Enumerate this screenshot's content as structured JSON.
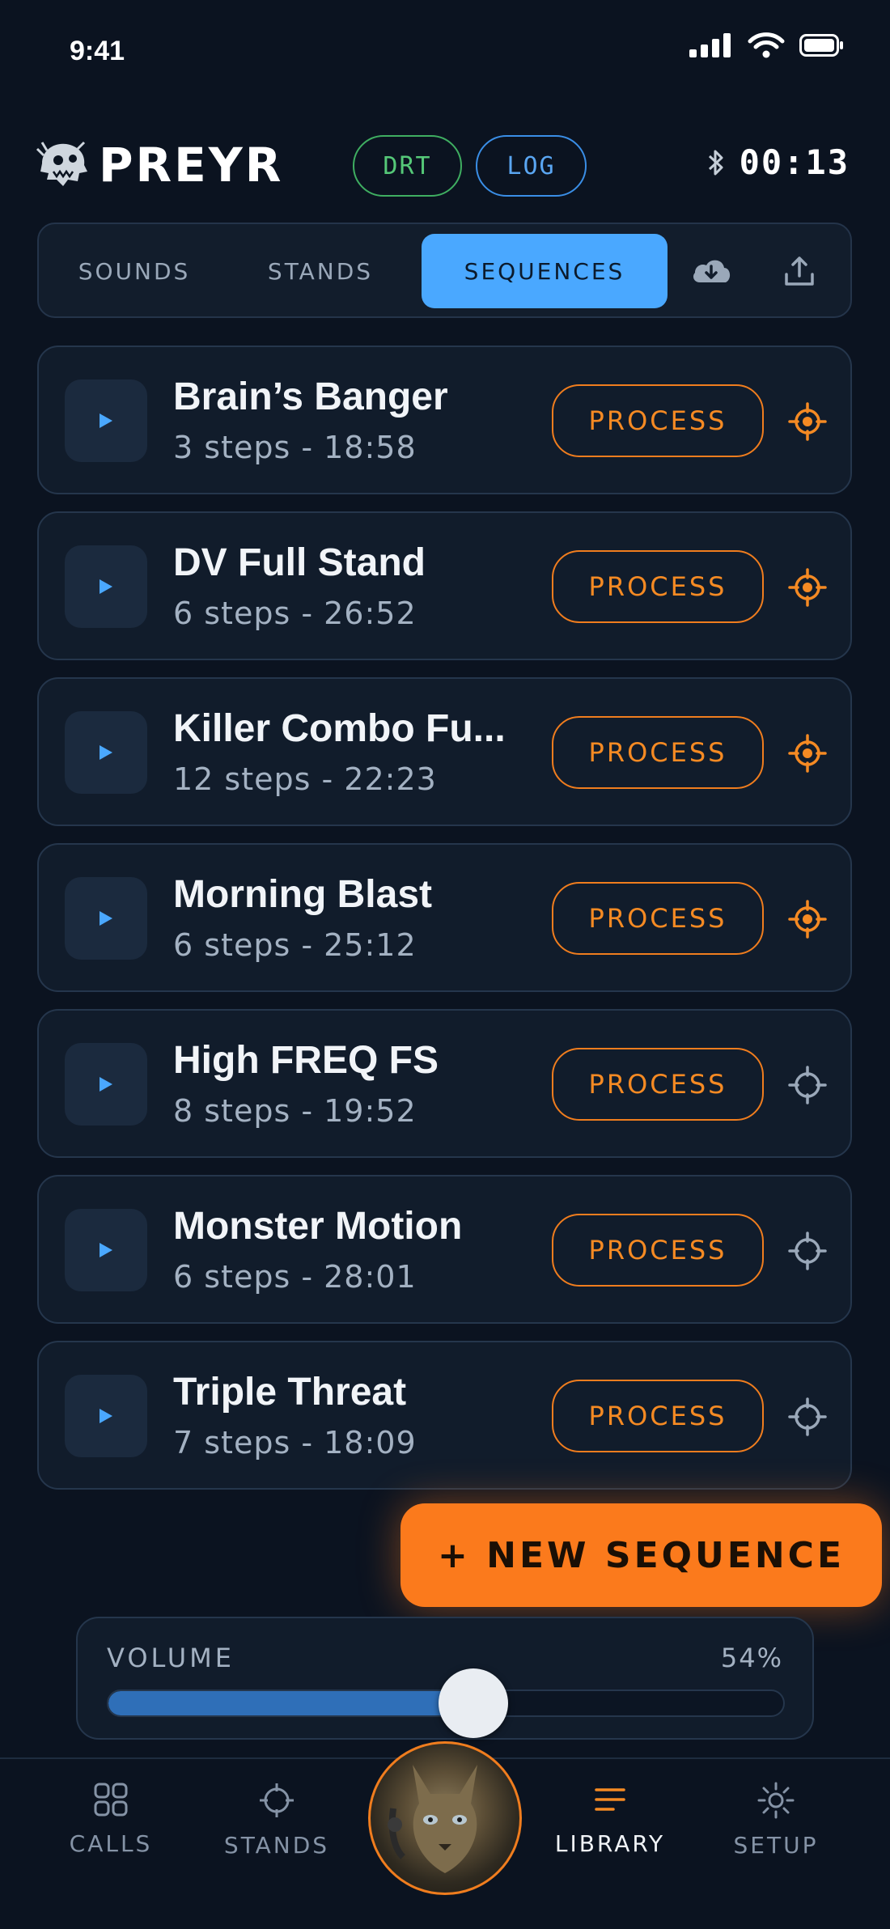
{
  "status_bar": {
    "time": "9:41"
  },
  "header": {
    "logo_text": "PREYR",
    "pill_drt": "DRT",
    "pill_log": "LOG",
    "timer": "00:13"
  },
  "tabs": {
    "sounds": "SOUNDS",
    "stands": "STANDS",
    "sequences": "SEQUENCES",
    "active": "SEQUENCES"
  },
  "sequences": [
    {
      "title": "Brain’s Banger",
      "meta": "3 steps - 18:58",
      "process_label": "PROCESS",
      "target_active": true
    },
    {
      "title": "DV Full Stand",
      "meta": "6 steps - 26:52",
      "process_label": "PROCESS",
      "target_active": true
    },
    {
      "title": "Killer Combo Fu...",
      "meta": "12 steps - 22:23",
      "process_label": "PROCESS",
      "target_active": true
    },
    {
      "title": "Morning Blast",
      "meta": "6 steps - 25:12",
      "process_label": "PROCESS",
      "target_active": true
    },
    {
      "title": "High FREQ FS",
      "meta": "8 steps - 19:52",
      "process_label": "PROCESS",
      "target_active": false
    },
    {
      "title": "Monster Motion",
      "meta": "6 steps - 28:01",
      "process_label": "PROCESS",
      "target_active": false
    },
    {
      "title": "Triple Threat",
      "meta": "7 steps - 18:09",
      "process_label": "PROCESS",
      "target_active": false
    }
  ],
  "new_sequence_label": "+ NEW SEQUENCE",
  "volume": {
    "label": "VOLUME",
    "value_text": "54%",
    "level": 0.54
  },
  "bottom_nav": {
    "calls": "CALLS",
    "stands": "STANDS",
    "library": "LIBRARY",
    "setup": "SETUP",
    "active": "LIBRARY"
  },
  "colors": {
    "background": "#0b1320",
    "accent_orange": "#f58a23",
    "accent_blue": "#4aa8ff",
    "drt_green": "#55c878",
    "log_blue": "#5aa6f2",
    "target_inactive": "#9aa8b9"
  }
}
